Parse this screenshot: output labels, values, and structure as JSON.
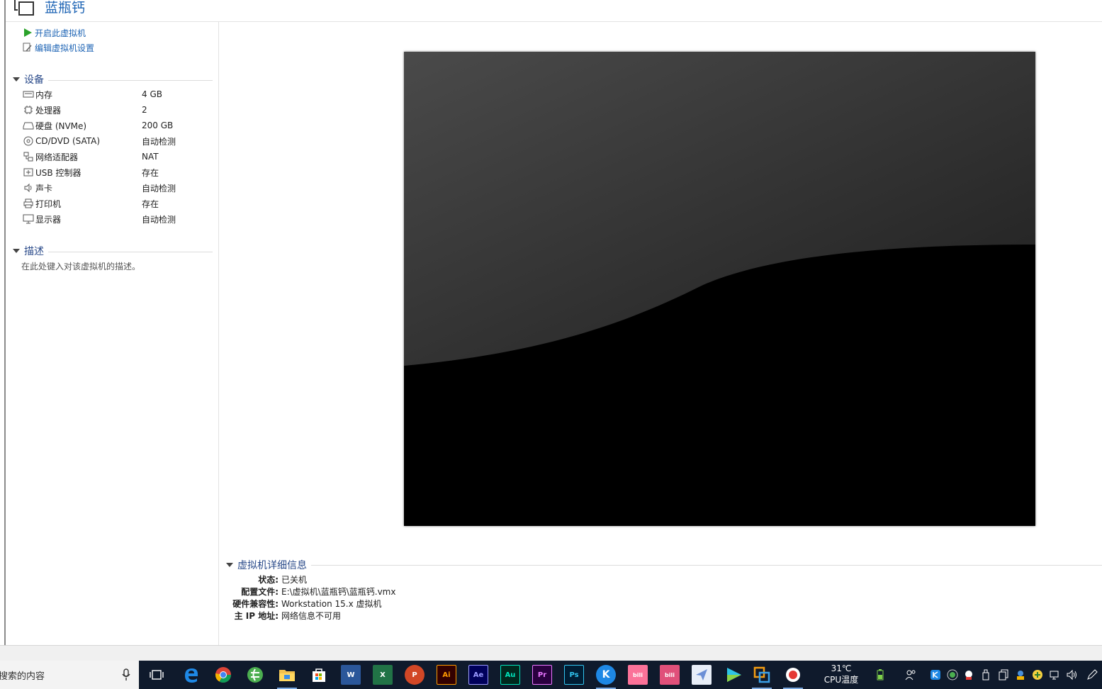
{
  "window": {
    "title": "蓝瓶钙"
  },
  "actions": [
    {
      "label": "开启此虚拟机",
      "icon": "play-icon"
    },
    {
      "label": "编辑虚拟机设置",
      "icon": "edit-settings-icon"
    }
  ],
  "devices": {
    "header": "设备",
    "items": [
      {
        "name": "内存",
        "value": "4 GB",
        "icon": "memory-icon"
      },
      {
        "name": "处理器",
        "value": "2",
        "icon": "processor-icon"
      },
      {
        "name": "硬盘 (NVMe)",
        "value": "200 GB",
        "icon": "hard-disk-icon"
      },
      {
        "name": "CD/DVD (SATA)",
        "value": "自动检测",
        "icon": "cd-dvd-icon"
      },
      {
        "name": "网络适配器",
        "value": "NAT",
        "icon": "network-adapter-icon"
      },
      {
        "name": "USB 控制器",
        "value": "存在",
        "icon": "usb-icon"
      },
      {
        "name": "声卡",
        "value": "自动检测",
        "icon": "speaker-icon"
      },
      {
        "name": "打印机",
        "value": "存在",
        "icon": "printer-icon"
      },
      {
        "name": "显示器",
        "value": "自动检测",
        "icon": "monitor-icon"
      }
    ]
  },
  "description": {
    "header": "描述",
    "placeholder": "在此处键入对该虚拟机的描述。"
  },
  "details": {
    "header": "虚拟机详细信息",
    "rows": [
      {
        "key": "状态:",
        "value": "已关机"
      },
      {
        "key": "配置文件:",
        "value": "E:\\虚拟机\\蓝瓶钙\\蓝瓶钙.vmx"
      },
      {
        "key": "硬件兼容性:",
        "value": "Workstation 15.x 虚拟机"
      },
      {
        "key": "主 IP 地址:",
        "value": "网络信息不可用"
      }
    ]
  },
  "taskbar": {
    "search_text": "搜索的内容",
    "apps": [
      {
        "name": "task-view-icon",
        "label": ""
      },
      {
        "name": "edge-icon",
        "label": ""
      },
      {
        "name": "chrome-icon",
        "label": ""
      },
      {
        "name": "360-browser-icon",
        "label": ""
      },
      {
        "name": "file-explorer-icon",
        "label": ""
      },
      {
        "name": "store-icon",
        "label": ""
      },
      {
        "name": "word-icon",
        "label": "W"
      },
      {
        "name": "excel-icon",
        "label": "X"
      },
      {
        "name": "powerpoint-icon",
        "label": "P"
      },
      {
        "name": "illustrator-icon",
        "label": "Ai"
      },
      {
        "name": "after-effects-icon",
        "label": "Ae"
      },
      {
        "name": "audition-icon",
        "label": "Au"
      },
      {
        "name": "premiere-icon",
        "label": "Pr"
      },
      {
        "name": "photoshop-icon",
        "label": "Ps"
      },
      {
        "name": "k-app-icon",
        "label": "K"
      },
      {
        "name": "bilibili-icon",
        "label": "bili"
      },
      {
        "name": "bilibili-2-icon",
        "label": "bili"
      },
      {
        "name": "paper-plane-icon",
        "label": ""
      },
      {
        "name": "video-player-icon",
        "label": ""
      },
      {
        "name": "vmware-icon",
        "label": ""
      },
      {
        "name": "recorder-icon",
        "label": ""
      }
    ],
    "temperature": "31℃",
    "temperature_label": "CPU温度"
  }
}
